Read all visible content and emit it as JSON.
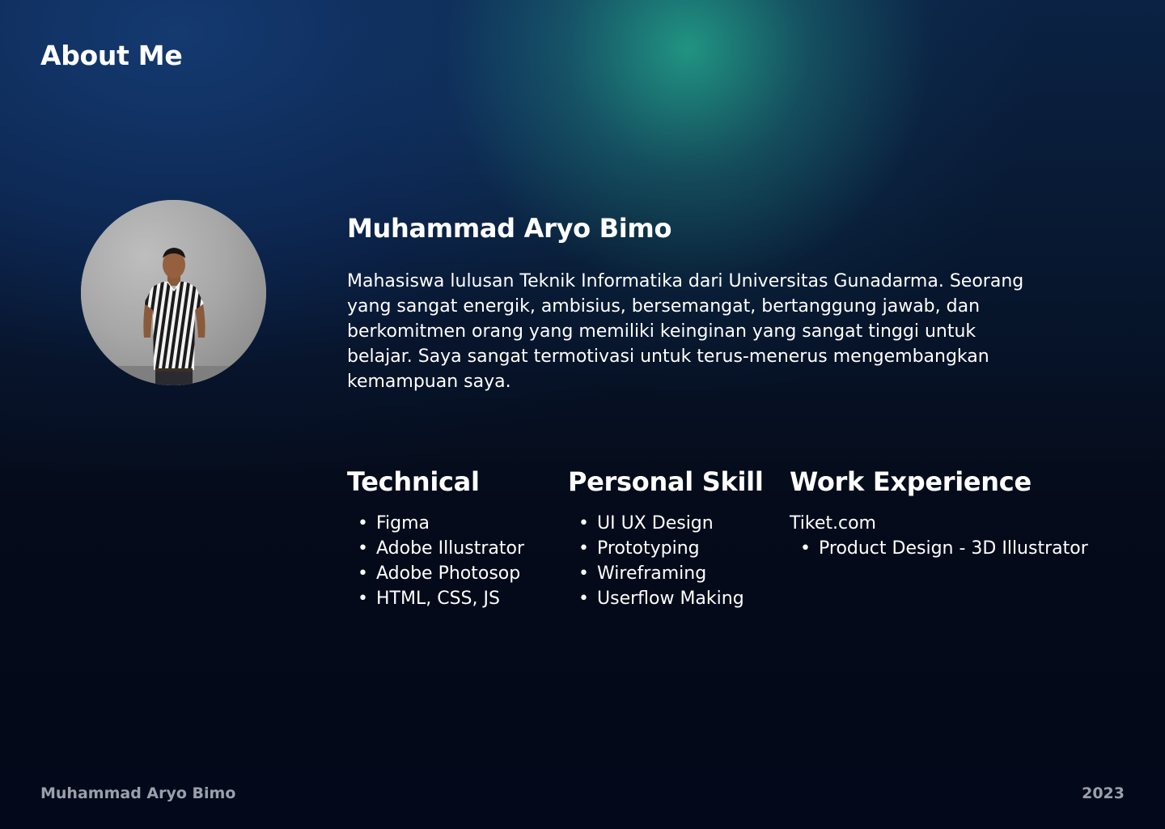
{
  "header": {
    "title": "About Me"
  },
  "profile": {
    "name": "Muhammad Aryo Bimo",
    "bio": "Mahasiswa lulusan Teknik Informatika dari Universitas Gunadarma. Seorang yang sangat energik, ambisius, bersemangat, bertanggung jawab, dan berkomitmen orang yang memiliki keinginan yang sangat tinggi untuk belajar. Saya sangat termotivasi untuk terus-menerus mengembangkan kemampuan saya.",
    "photo_icon": "person-photo"
  },
  "sections": {
    "technical": {
      "heading": "Technical",
      "items": [
        "Figma",
        "Adobe Illustrator",
        "Adobe Photosop",
        "HTML, CSS, JS"
      ]
    },
    "personal": {
      "heading": "Personal Skill",
      "items": [
        "UI UX Design",
        "Prototyping",
        "Wireframing",
        "Userflow Making"
      ]
    },
    "work": {
      "heading": "Work Experience",
      "company": "Tiket.com",
      "roles": [
        "Product Design - 3D Illustrator"
      ]
    }
  },
  "footer": {
    "name": "Muhammad Aryo Bimo",
    "year": "2023"
  },
  "bullet": "•",
  "colors": {
    "text": "#ffffff",
    "footer_text": "#9aa0ab",
    "glow_teal": "#229a86",
    "deep_navy": "#03081a"
  }
}
